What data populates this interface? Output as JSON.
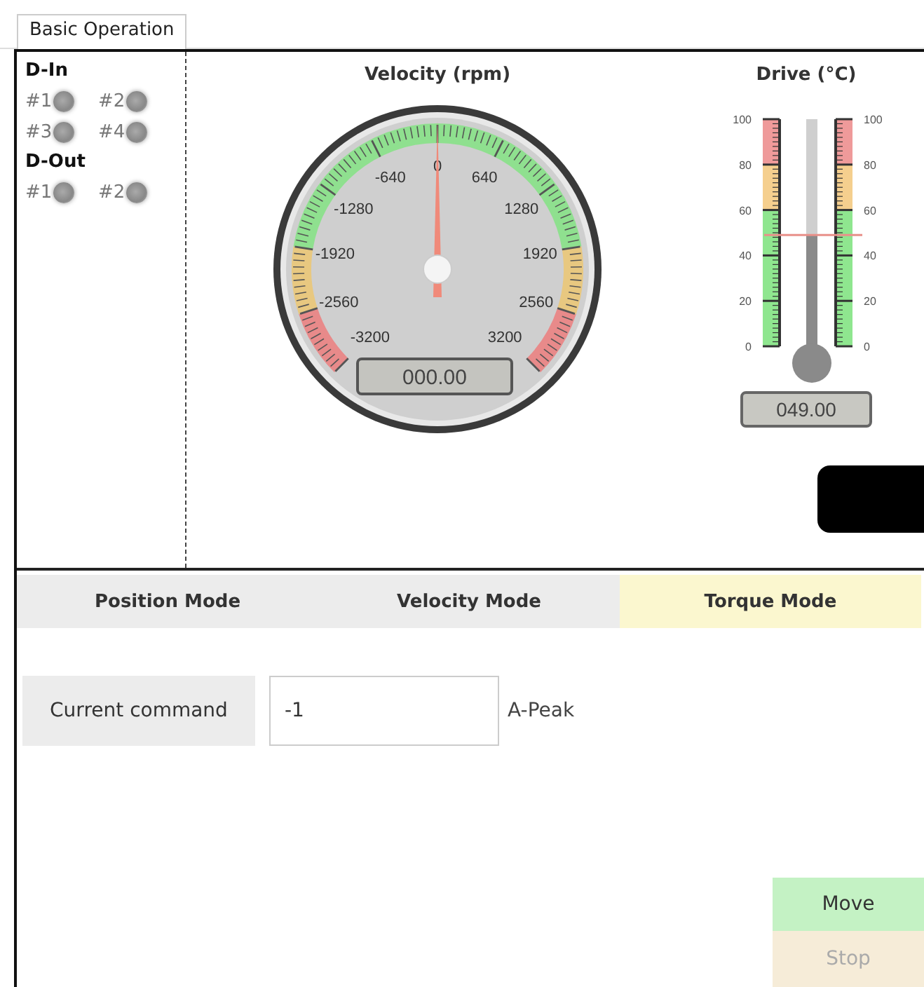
{
  "tab": {
    "label": "Basic Operation",
    "selected": true
  },
  "io": [
    {
      "title": "D-In",
      "pins": [
        {
          "label": "#1",
          "on": false
        },
        {
          "label": "#2",
          "on": false
        },
        {
          "label": "#3",
          "on": false
        },
        {
          "label": "#4",
          "on": false
        }
      ]
    },
    {
      "title": "D-Out",
      "pins": [
        {
          "label": "#1",
          "on": false
        },
        {
          "label": "#2",
          "on": false
        }
      ]
    }
  ],
  "velocity": {
    "title": "Velocity (rpm)",
    "scale_labels": [
      "-3200",
      "-2560",
      "-1920",
      "-1280",
      "-640",
      "0",
      "640",
      "1280",
      "1920",
      "2560",
      "3200"
    ],
    "level": 0.5,
    "readout": "000.00"
  },
  "drive": {
    "title": "Drive (°C)",
    "left_labels": [
      "100",
      "80",
      "60",
      "40",
      "20",
      "0"
    ],
    "right_labels": [
      "100",
      "80",
      "60",
      "40",
      "20",
      "0"
    ],
    "level": 0.49,
    "readout": "049.00"
  },
  "modes": [
    {
      "label": "Position Mode",
      "selected": false
    },
    {
      "label": "Velocity Mode",
      "selected": false
    },
    {
      "label": "Torque Mode",
      "selected": true
    }
  ],
  "command": {
    "label": "Current command",
    "value": "-1",
    "unit": "A-Peak"
  },
  "buttons": [
    {
      "label": "Move",
      "disabled": false
    },
    {
      "label": "Stop",
      "disabled": true
    }
  ]
}
